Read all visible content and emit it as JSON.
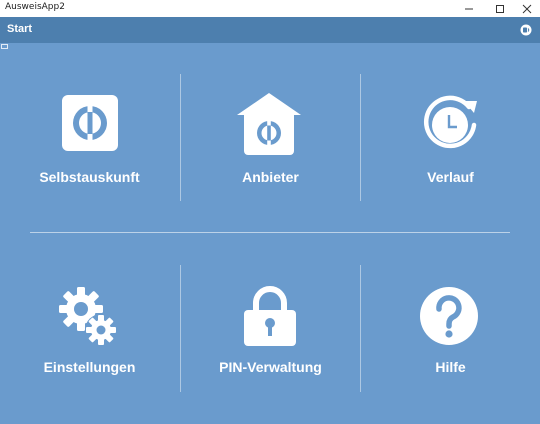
{
  "window": {
    "title": "AusweisApp2",
    "controls": [
      "minimize-icon",
      "maximize-icon",
      "close-icon"
    ]
  },
  "header": {
    "title": "Start",
    "icon": "card-reader-icon"
  },
  "colors": {
    "header_bg": "#4d7fae",
    "main_bg": "#6a9bcd",
    "tile_fg": "#ffffff"
  },
  "tiles": [
    {
      "label": "Selbstauskunft",
      "icon": "id-card-icon"
    },
    {
      "label": "Anbieter",
      "icon": "provider-house-icon"
    },
    {
      "label": "Verlauf",
      "icon": "history-clock-icon"
    },
    {
      "label": "Einstellungen",
      "icon": "settings-gears-icon"
    },
    {
      "label": "PIN-Verwaltung",
      "icon": "padlock-icon"
    },
    {
      "label": "Hilfe",
      "icon": "help-question-icon"
    }
  ]
}
